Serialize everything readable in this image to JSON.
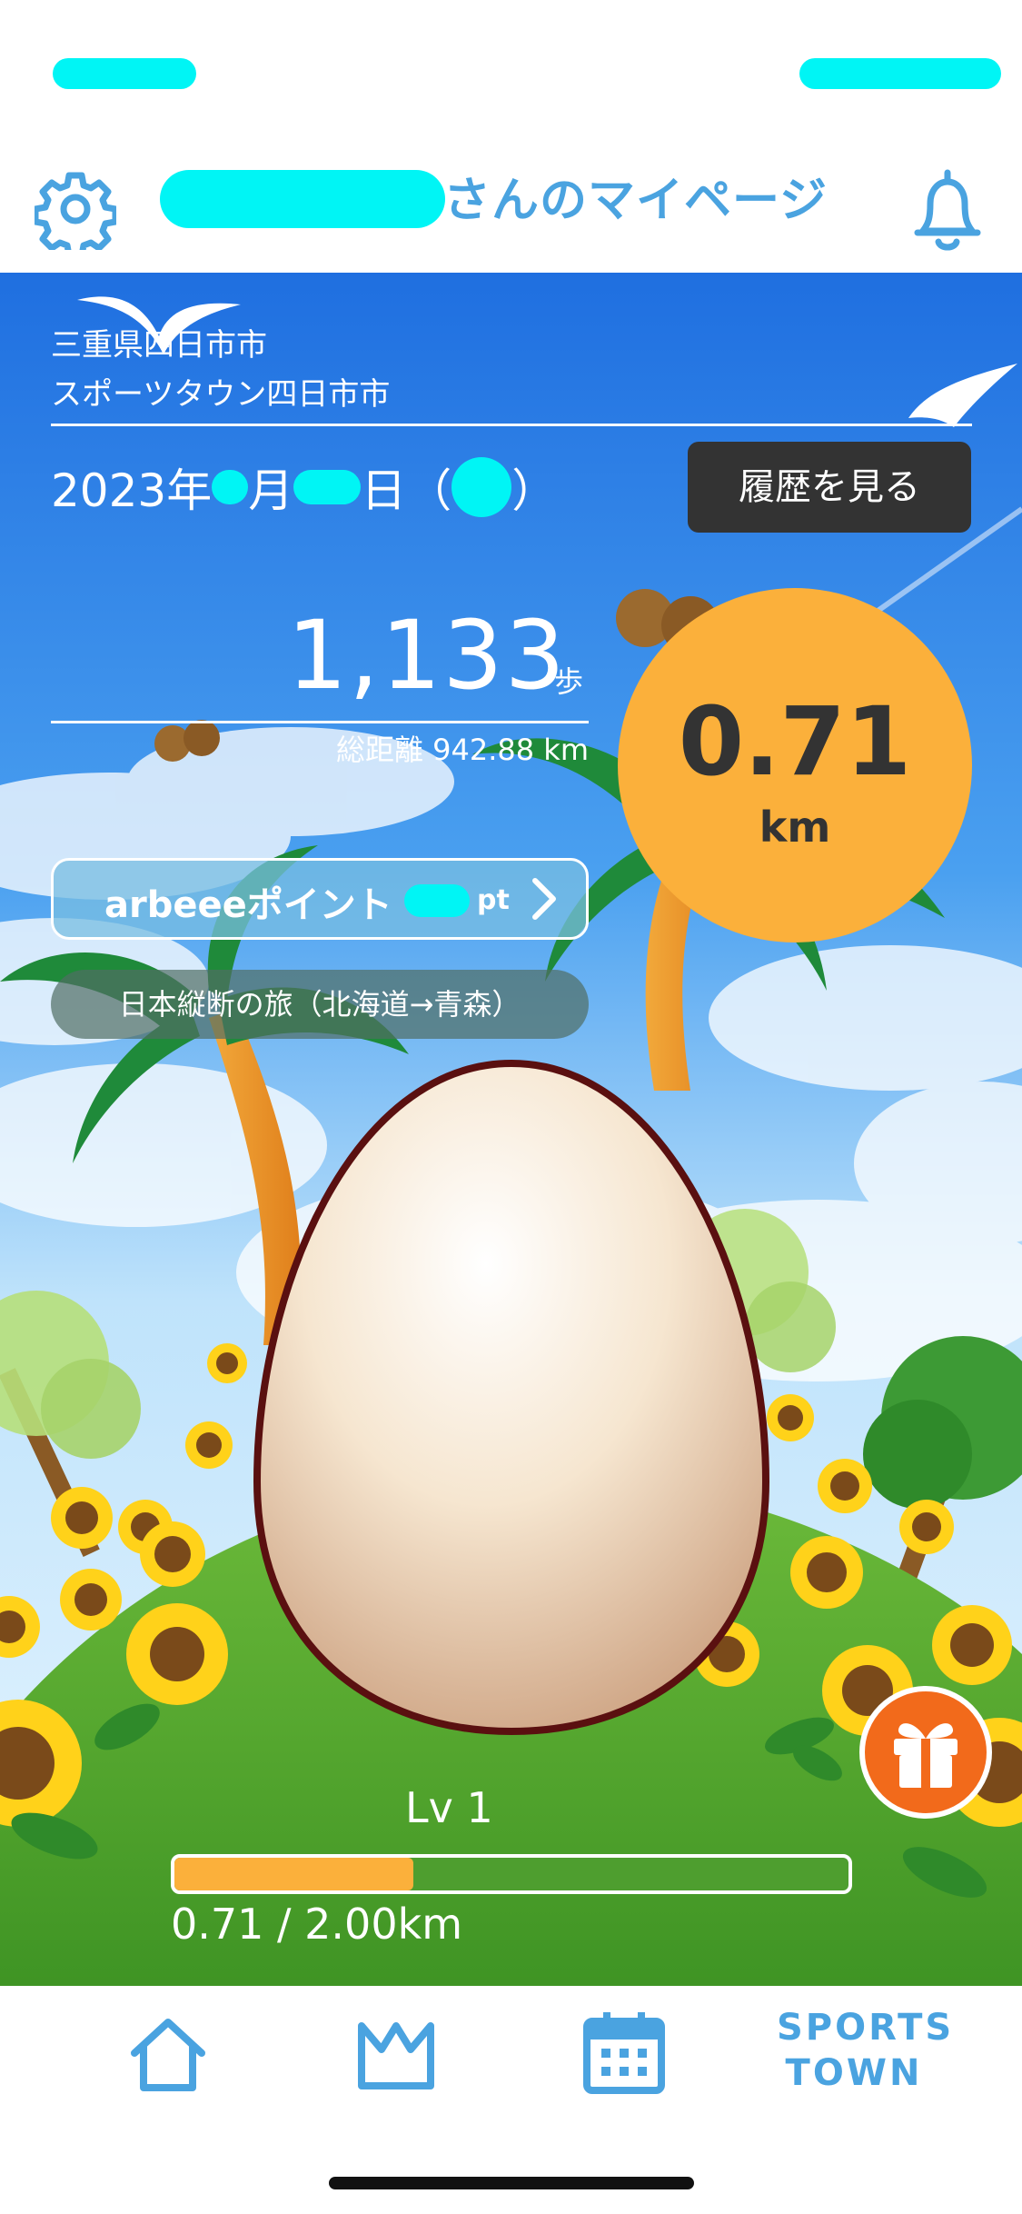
{
  "header": {
    "title": "さんのマイページ",
    "accent_color": "#4aa3e0",
    "icons": {
      "left": "gear-icon",
      "right": "bell-icon"
    }
  },
  "location": {
    "prefecture_city": "三重県四日市市",
    "town": "スポーツタウン四日市市"
  },
  "date": {
    "year_prefix": "2023年",
    "month_suffix": "月",
    "day_suffix": "日",
    "paren_open": "（",
    "paren_close": "）"
  },
  "history_button": {
    "label": "履歴を見る"
  },
  "steps": {
    "count": "1,133",
    "unit": "歩",
    "total_distance": "総距離 942.88 km"
  },
  "distance_today": {
    "value": "0.71",
    "unit": "km",
    "color": "#fbb03b"
  },
  "points": {
    "label": "arbeeeポイント",
    "unit": "pt"
  },
  "journey": {
    "label": "日本縦断の旅（北海道→青森）"
  },
  "level": {
    "label": "Lv 1",
    "progress_text": "0.71 / 2.00km",
    "progress_fraction": 0.355
  },
  "nav": {
    "items": [
      "home-icon",
      "crown-icon",
      "calendar-icon"
    ],
    "sports_line1": "SPORTS",
    "sports_line2": "TOWN"
  }
}
